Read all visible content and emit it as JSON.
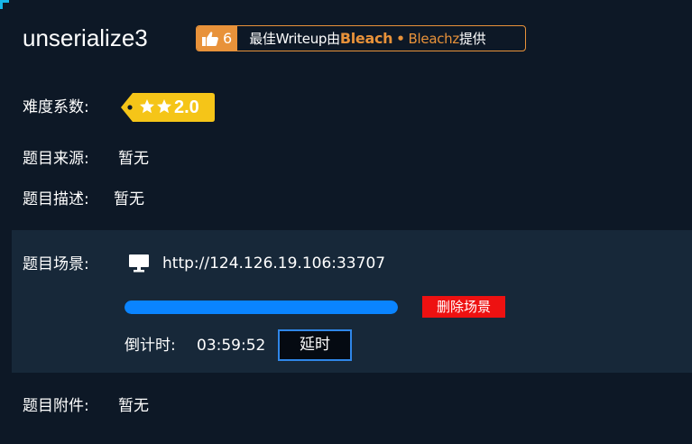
{
  "challenge": {
    "title": "unserialize3"
  },
  "writeup_badge": {
    "like_count": "6",
    "text_prefix": "最佳Writeup由",
    "author": "Bleach",
    "separator": "•",
    "author_alias": "Bleachz",
    "text_suffix": "提供",
    "accent_color": "#e8923a"
  },
  "difficulty": {
    "label": "难度系数:",
    "value": "2.0",
    "stars": 2,
    "tag_color": "#f5c518"
  },
  "source": {
    "label": "题目来源:",
    "value": "暂无"
  },
  "description": {
    "label": "题目描述:",
    "value": "暂无"
  },
  "scene": {
    "label": "题目场景:",
    "url": "http://124.126.19.106:33707",
    "progress_percent": 100,
    "delete_label": "删除场景",
    "countdown_label": "倒计时:",
    "countdown_value": "03:59:52",
    "extend_label": "延时",
    "progress_color": "#0a84ff",
    "delete_color": "#ee1111"
  },
  "attachment": {
    "label": "题目附件:",
    "value": "暂无"
  }
}
